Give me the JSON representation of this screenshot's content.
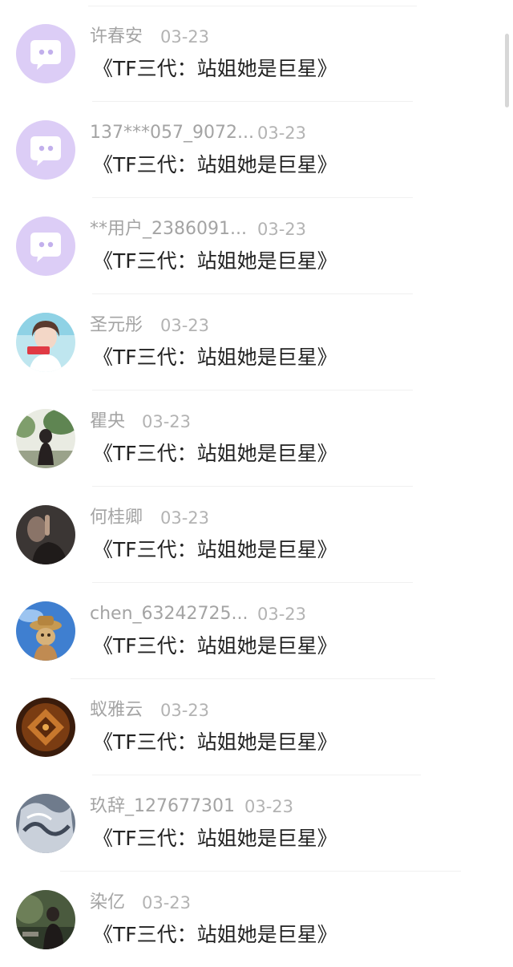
{
  "comments": [
    {
      "user": "许春安",
      "date": "03-23",
      "text": "《TF三代：站姐她是巨星》",
      "avatar": "default-chat-avatar-icon"
    },
    {
      "user": "137***057_9072...",
      "date": "03-23",
      "text": "《TF三代：站姐她是巨星》",
      "avatar": "default-chat-avatar-icon"
    },
    {
      "user": "**用户_2386091...",
      "date": "03-23",
      "text": "《TF三代：站姐她是巨星》",
      "avatar": "default-chat-avatar-icon"
    },
    {
      "user": "圣元彤",
      "date": "03-23",
      "text": "《TF三代：站姐她是巨星》",
      "avatar": "user-photo-avatar"
    },
    {
      "user": "瞿央",
      "date": "03-23",
      "text": "《TF三代：站姐她是巨星》",
      "avatar": "user-photo-avatar"
    },
    {
      "user": "何桂卿",
      "date": "03-23",
      "text": "《TF三代：站姐她是巨星》",
      "avatar": "user-photo-avatar"
    },
    {
      "user": "chen_63242725...",
      "date": "03-23",
      "text": "《TF三代：站姐她是巨星》",
      "avatar": "user-photo-avatar"
    },
    {
      "user": "蚁雅云",
      "date": "03-23",
      "text": "《TF三代：站姐她是巨星》",
      "avatar": "user-photo-avatar"
    },
    {
      "user": "玖辞_127677301",
      "date": "03-23",
      "text": "《TF三代：站姐她是巨星》",
      "avatar": "user-photo-avatar"
    },
    {
      "user": "染亿",
      "date": "03-23",
      "text": "《TF三代：站姐她是巨星》",
      "avatar": "user-photo-avatar"
    }
  ],
  "colors": {
    "default_avatar_bg": "#dccdf6",
    "username": "#a4a4a4",
    "date": "#b3b3b3",
    "message": "#222222",
    "divider": "#f0f0f0"
  }
}
